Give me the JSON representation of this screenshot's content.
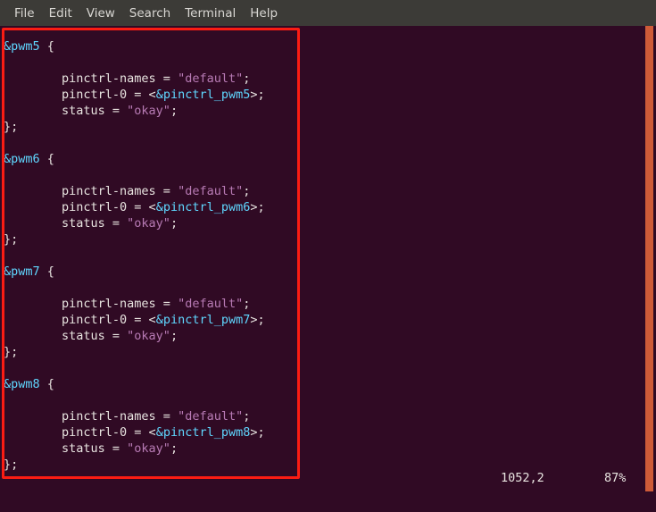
{
  "window": {
    "app": "terminal",
    "background_color": "#300a24",
    "menubar_color": "#3c3b37"
  },
  "menubar": {
    "items": [
      {
        "label": "File",
        "name": "menu-file"
      },
      {
        "label": "Edit",
        "name": "menu-edit"
      },
      {
        "label": "View",
        "name": "menu-view"
      },
      {
        "label": "Search",
        "name": "menu-search"
      },
      {
        "label": "Terminal",
        "name": "menu-terminal"
      },
      {
        "label": "Help",
        "name": "menu-help"
      }
    ]
  },
  "editor": {
    "colors": {
      "node_reference": "#5fd7ff",
      "plain_text": "#e8e4e0",
      "string_literal": "#b77ab4",
      "annotation_rect": "#fb1c13",
      "scrollbar": "#cf5b38"
    },
    "lines": [
      {
        "tokens": [
          {
            "t": "&pwm5",
            "c": "node"
          },
          {
            "t": " {",
            "c": "plain"
          }
        ]
      },
      {
        "tokens": []
      },
      {
        "tokens": [
          {
            "t": "        pinctrl-names = ",
            "c": "plain"
          },
          {
            "t": "\"default\"",
            "c": "str"
          },
          {
            "t": ";",
            "c": "plain"
          }
        ]
      },
      {
        "tokens": [
          {
            "t": "        pinctrl-0 = <",
            "c": "plain"
          },
          {
            "t": "&pinctrl_pwm5",
            "c": "node"
          },
          {
            "t": ">;",
            "c": "plain"
          }
        ]
      },
      {
        "tokens": [
          {
            "t": "        status = ",
            "c": "plain"
          },
          {
            "t": "\"okay\"",
            "c": "str"
          },
          {
            "t": ";",
            "c": "plain"
          }
        ]
      },
      {
        "tokens": [
          {
            "t": "};",
            "c": "plain"
          }
        ]
      },
      {
        "tokens": []
      },
      {
        "tokens": [
          {
            "t": "&pwm6",
            "c": "node"
          },
          {
            "t": " {",
            "c": "plain"
          }
        ]
      },
      {
        "tokens": []
      },
      {
        "tokens": [
          {
            "t": "        pinctrl-names = ",
            "c": "plain"
          },
          {
            "t": "\"default\"",
            "c": "str"
          },
          {
            "t": ";",
            "c": "plain"
          }
        ]
      },
      {
        "tokens": [
          {
            "t": "        pinctrl-0 = <",
            "c": "plain"
          },
          {
            "t": "&pinctrl_pwm6",
            "c": "node"
          },
          {
            "t": ">;",
            "c": "plain"
          }
        ]
      },
      {
        "tokens": [
          {
            "t": "        status = ",
            "c": "plain"
          },
          {
            "t": "\"okay\"",
            "c": "str"
          },
          {
            "t": ";",
            "c": "plain"
          }
        ]
      },
      {
        "tokens": [
          {
            "t": "};",
            "c": "plain"
          }
        ]
      },
      {
        "tokens": []
      },
      {
        "tokens": [
          {
            "t": "&pwm7",
            "c": "node"
          },
          {
            "t": " {",
            "c": "plain"
          }
        ]
      },
      {
        "tokens": []
      },
      {
        "tokens": [
          {
            "t": "        pinctrl-names = ",
            "c": "plain"
          },
          {
            "t": "\"default\"",
            "c": "str"
          },
          {
            "t": ";",
            "c": "plain"
          }
        ]
      },
      {
        "tokens": [
          {
            "t": "        pinctrl-0 = <",
            "c": "plain"
          },
          {
            "t": "&pinctrl_pwm7",
            "c": "node"
          },
          {
            "t": ">;",
            "c": "plain"
          }
        ]
      },
      {
        "tokens": [
          {
            "t": "        status = ",
            "c": "plain"
          },
          {
            "t": "\"okay\"",
            "c": "str"
          },
          {
            "t": ";",
            "c": "plain"
          }
        ]
      },
      {
        "tokens": [
          {
            "t": "};",
            "c": "plain"
          }
        ]
      },
      {
        "tokens": []
      },
      {
        "tokens": [
          {
            "t": "&pwm8",
            "c": "node"
          },
          {
            "t": " {",
            "c": "plain"
          }
        ]
      },
      {
        "tokens": []
      },
      {
        "tokens": [
          {
            "t": "        pinctrl-names = ",
            "c": "plain"
          },
          {
            "t": "\"default\"",
            "c": "str"
          },
          {
            "t": ";",
            "c": "plain"
          }
        ]
      },
      {
        "tokens": [
          {
            "t": "        pinctrl-0 = <",
            "c": "plain"
          },
          {
            "t": "&pinctrl_pwm8",
            "c": "node"
          },
          {
            "t": ">;",
            "c": "plain"
          }
        ]
      },
      {
        "tokens": [
          {
            "t": "        status = ",
            "c": "plain"
          },
          {
            "t": "\"okay\"",
            "c": "str"
          },
          {
            "t": ";",
            "c": "plain"
          }
        ]
      },
      {
        "tokens": [
          {
            "t": "};",
            "c": "plain"
          }
        ]
      }
    ]
  },
  "statusline": {
    "cursor_position": "1052,2",
    "scroll_percent": "87%"
  }
}
